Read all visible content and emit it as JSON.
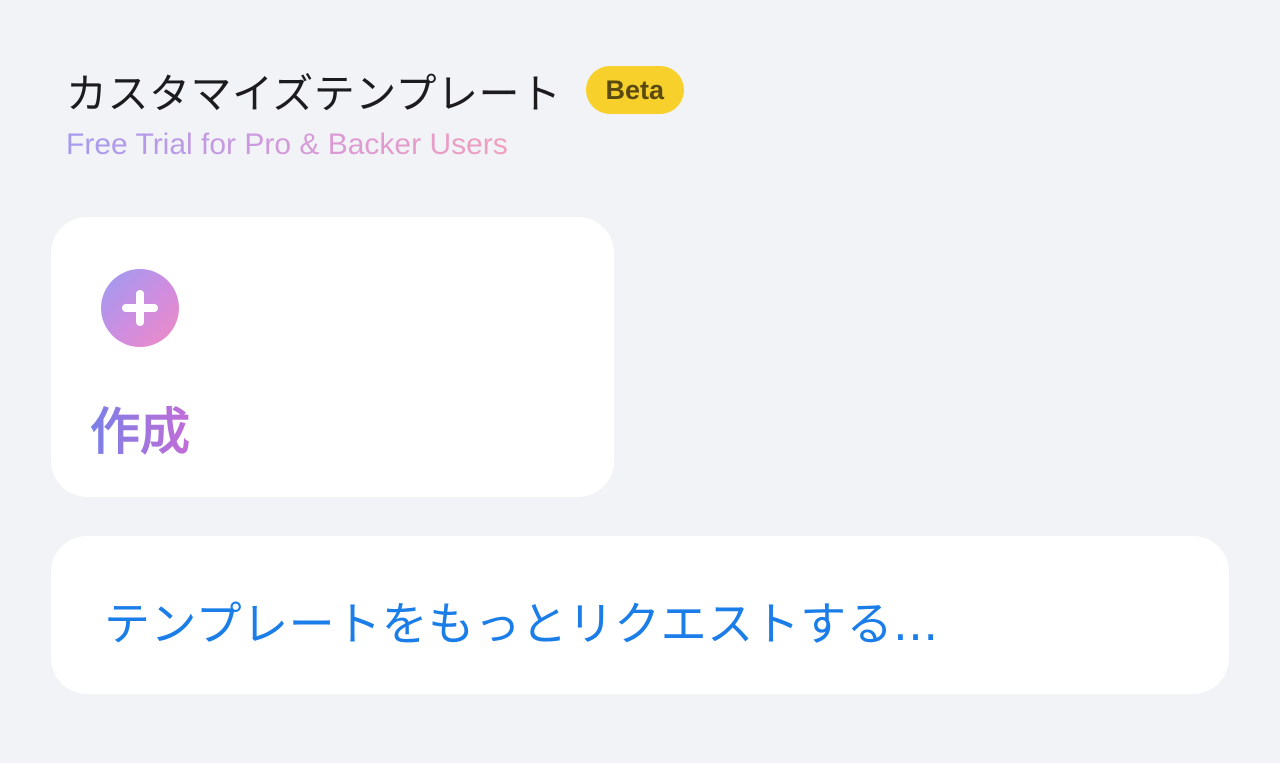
{
  "header": {
    "title": "カスタマイズテンプレート",
    "badge": "Beta",
    "subtitle": "Free Trial for Pro & Backer Users"
  },
  "create_card": {
    "icon": "plus-circle-icon",
    "label": "作成"
  },
  "request_card": {
    "label": "テンプレートをもっとリクエストする..."
  },
  "colors": {
    "background": "#f2f3f7",
    "badge": "#f7d02c",
    "link": "#1a7de8",
    "gradient_start": "#9b9cf2",
    "gradient_end": "#f08ac2"
  }
}
